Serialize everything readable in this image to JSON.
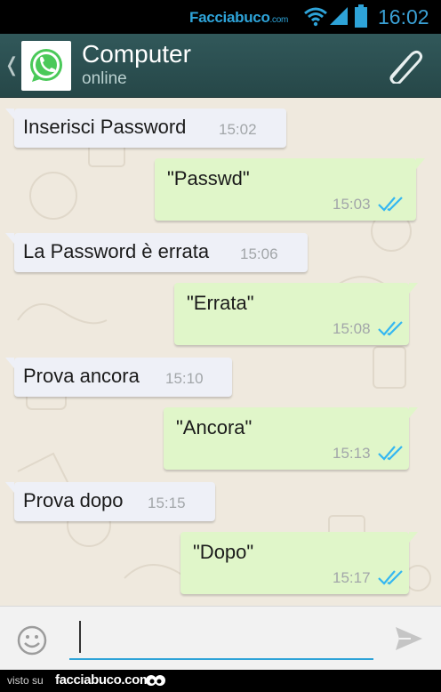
{
  "status_bar": {
    "brand": "Facciabuco",
    "brand_suffix": ".com",
    "time": "16:02",
    "icons": [
      "wifi-icon",
      "signal-icon",
      "battery-icon"
    ]
  },
  "header": {
    "back_glyph": "❬",
    "contact_name": "Computer",
    "contact_status": "online",
    "icons": [
      "whatsapp-logo-icon",
      "paperclip-icon"
    ]
  },
  "messages": [
    {
      "direction": "in",
      "text": "Inserisci Password",
      "time": "15:02"
    },
    {
      "direction": "out",
      "text": "\"Passwd\"",
      "time": "15:03",
      "status": "double-check-icon"
    },
    {
      "direction": "in",
      "text": "La Password è errata",
      "time": "15:06"
    },
    {
      "direction": "out",
      "text": "\"Errata\"",
      "time": "15:08",
      "status": "double-check-icon"
    },
    {
      "direction": "in",
      "text": "Prova ancora",
      "time": "15:10"
    },
    {
      "direction": "out",
      "text": "\"Ancora\"",
      "time": "15:13",
      "status": "double-check-icon"
    },
    {
      "direction": "in",
      "text": "Prova dopo",
      "time": "15:15"
    },
    {
      "direction": "out",
      "text": "\"Dopo\"",
      "time": "15:17",
      "status": "double-check-icon"
    }
  ],
  "composer": {
    "value": "",
    "icons": [
      "emoji-icon",
      "send-icon"
    ]
  },
  "footer": {
    "label": "visto su",
    "brand": "facciabuco.com"
  },
  "colors": {
    "header": "#2b4f50",
    "incoming_bubble": "#eef0f7",
    "outgoing_bubble": "#e0f6c9",
    "read_ticks": "#34b7f1",
    "accent": "#2ea3d8"
  }
}
